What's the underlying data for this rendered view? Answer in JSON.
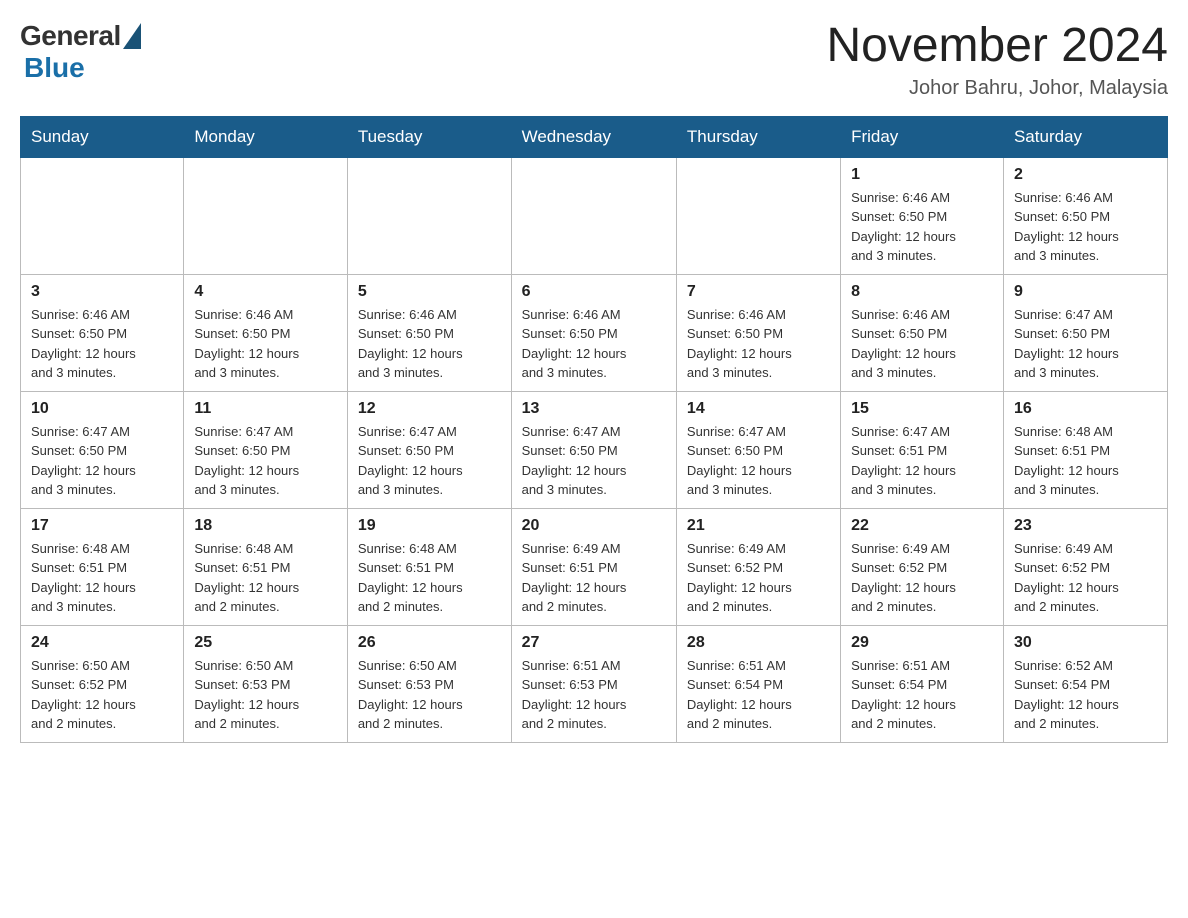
{
  "header": {
    "logo_general": "General",
    "logo_blue": "Blue",
    "month_title": "November 2024",
    "location": "Johor Bahru, Johor, Malaysia"
  },
  "days_of_week": [
    "Sunday",
    "Monday",
    "Tuesday",
    "Wednesday",
    "Thursday",
    "Friday",
    "Saturday"
  ],
  "weeks": [
    {
      "days": [
        {
          "number": "",
          "info": ""
        },
        {
          "number": "",
          "info": ""
        },
        {
          "number": "",
          "info": ""
        },
        {
          "number": "",
          "info": ""
        },
        {
          "number": "",
          "info": ""
        },
        {
          "number": "1",
          "info": "Sunrise: 6:46 AM\nSunset: 6:50 PM\nDaylight: 12 hours\nand 3 minutes."
        },
        {
          "number": "2",
          "info": "Sunrise: 6:46 AM\nSunset: 6:50 PM\nDaylight: 12 hours\nand 3 minutes."
        }
      ]
    },
    {
      "days": [
        {
          "number": "3",
          "info": "Sunrise: 6:46 AM\nSunset: 6:50 PM\nDaylight: 12 hours\nand 3 minutes."
        },
        {
          "number": "4",
          "info": "Sunrise: 6:46 AM\nSunset: 6:50 PM\nDaylight: 12 hours\nand 3 minutes."
        },
        {
          "number": "5",
          "info": "Sunrise: 6:46 AM\nSunset: 6:50 PM\nDaylight: 12 hours\nand 3 minutes."
        },
        {
          "number": "6",
          "info": "Sunrise: 6:46 AM\nSunset: 6:50 PM\nDaylight: 12 hours\nand 3 minutes."
        },
        {
          "number": "7",
          "info": "Sunrise: 6:46 AM\nSunset: 6:50 PM\nDaylight: 12 hours\nand 3 minutes."
        },
        {
          "number": "8",
          "info": "Sunrise: 6:46 AM\nSunset: 6:50 PM\nDaylight: 12 hours\nand 3 minutes."
        },
        {
          "number": "9",
          "info": "Sunrise: 6:47 AM\nSunset: 6:50 PM\nDaylight: 12 hours\nand 3 minutes."
        }
      ]
    },
    {
      "days": [
        {
          "number": "10",
          "info": "Sunrise: 6:47 AM\nSunset: 6:50 PM\nDaylight: 12 hours\nand 3 minutes."
        },
        {
          "number": "11",
          "info": "Sunrise: 6:47 AM\nSunset: 6:50 PM\nDaylight: 12 hours\nand 3 minutes."
        },
        {
          "number": "12",
          "info": "Sunrise: 6:47 AM\nSunset: 6:50 PM\nDaylight: 12 hours\nand 3 minutes."
        },
        {
          "number": "13",
          "info": "Sunrise: 6:47 AM\nSunset: 6:50 PM\nDaylight: 12 hours\nand 3 minutes."
        },
        {
          "number": "14",
          "info": "Sunrise: 6:47 AM\nSunset: 6:50 PM\nDaylight: 12 hours\nand 3 minutes."
        },
        {
          "number": "15",
          "info": "Sunrise: 6:47 AM\nSunset: 6:51 PM\nDaylight: 12 hours\nand 3 minutes."
        },
        {
          "number": "16",
          "info": "Sunrise: 6:48 AM\nSunset: 6:51 PM\nDaylight: 12 hours\nand 3 minutes."
        }
      ]
    },
    {
      "days": [
        {
          "number": "17",
          "info": "Sunrise: 6:48 AM\nSunset: 6:51 PM\nDaylight: 12 hours\nand 3 minutes."
        },
        {
          "number": "18",
          "info": "Sunrise: 6:48 AM\nSunset: 6:51 PM\nDaylight: 12 hours\nand 2 minutes."
        },
        {
          "number": "19",
          "info": "Sunrise: 6:48 AM\nSunset: 6:51 PM\nDaylight: 12 hours\nand 2 minutes."
        },
        {
          "number": "20",
          "info": "Sunrise: 6:49 AM\nSunset: 6:51 PM\nDaylight: 12 hours\nand 2 minutes."
        },
        {
          "number": "21",
          "info": "Sunrise: 6:49 AM\nSunset: 6:52 PM\nDaylight: 12 hours\nand 2 minutes."
        },
        {
          "number": "22",
          "info": "Sunrise: 6:49 AM\nSunset: 6:52 PM\nDaylight: 12 hours\nand 2 minutes."
        },
        {
          "number": "23",
          "info": "Sunrise: 6:49 AM\nSunset: 6:52 PM\nDaylight: 12 hours\nand 2 minutes."
        }
      ]
    },
    {
      "days": [
        {
          "number": "24",
          "info": "Sunrise: 6:50 AM\nSunset: 6:52 PM\nDaylight: 12 hours\nand 2 minutes."
        },
        {
          "number": "25",
          "info": "Sunrise: 6:50 AM\nSunset: 6:53 PM\nDaylight: 12 hours\nand 2 minutes."
        },
        {
          "number": "26",
          "info": "Sunrise: 6:50 AM\nSunset: 6:53 PM\nDaylight: 12 hours\nand 2 minutes."
        },
        {
          "number": "27",
          "info": "Sunrise: 6:51 AM\nSunset: 6:53 PM\nDaylight: 12 hours\nand 2 minutes."
        },
        {
          "number": "28",
          "info": "Sunrise: 6:51 AM\nSunset: 6:54 PM\nDaylight: 12 hours\nand 2 minutes."
        },
        {
          "number": "29",
          "info": "Sunrise: 6:51 AM\nSunset: 6:54 PM\nDaylight: 12 hours\nand 2 minutes."
        },
        {
          "number": "30",
          "info": "Sunrise: 6:52 AM\nSunset: 6:54 PM\nDaylight: 12 hours\nand 2 minutes."
        }
      ]
    }
  ]
}
